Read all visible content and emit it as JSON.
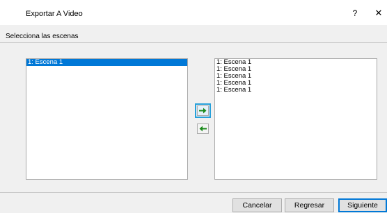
{
  "window": {
    "title": "Exportar A Video",
    "help_label": "?",
    "close_label": "✕"
  },
  "section": {
    "label": "Selecciona las escenas"
  },
  "available_scenes": [
    {
      "label": "1: Escena 1",
      "selected": true
    }
  ],
  "selected_scenes": [
    {
      "label": "1: Escena 1"
    },
    {
      "label": "1: Escena 1"
    },
    {
      "label": "1: Escena 1"
    },
    {
      "label": "1: Escena 1"
    },
    {
      "label": "1: Escena 1"
    }
  ],
  "transfer": {
    "add_icon": "arrow-right-icon",
    "remove_icon": "arrow-left-icon",
    "arrow_color": "#1a8a1a"
  },
  "footer": {
    "cancel_label": "Cancelar",
    "back_label": "Regresar",
    "next_label": "Siguiente"
  }
}
